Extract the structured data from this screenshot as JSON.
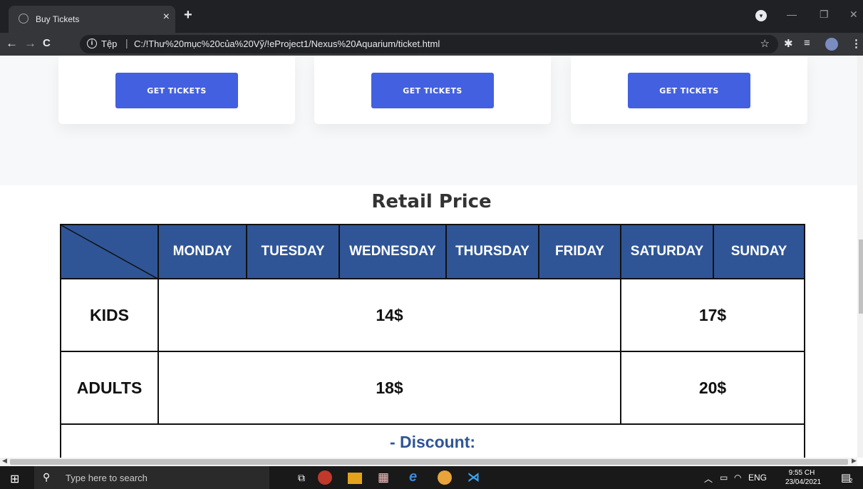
{
  "browser": {
    "tab_title": "Buy Tickets",
    "tab_close": "×",
    "new_tab": "+",
    "scheme_label": "Tệp",
    "separator": "|",
    "url": "C:/!Thư%20mục%20của%20Vỹ/!eProject1/Nexus%20Aquarium/ticket.html",
    "minimize": "—",
    "restore": "❐",
    "close": "✕"
  },
  "cards": [
    {
      "button_label": "GET TICKETS"
    },
    {
      "button_label": "GET TICKETS"
    },
    {
      "button_label": "GET TICKETS"
    }
  ],
  "retail": {
    "title": "Retail Price",
    "days": [
      "MONDAY",
      "TUESDAY",
      "WEDNESDAY",
      "THURSDAY",
      "FRIDAY",
      "SATURDAY",
      "SUNDAY"
    ],
    "rows": [
      {
        "label": "KIDS",
        "weekday_price": "14$",
        "weekend_price": "17$"
      },
      {
        "label": "ADULTS",
        "weekday_price": "18$",
        "weekend_price": "20$"
      }
    ],
    "discount_label": "- Discount:"
  },
  "taskbar": {
    "search_placeholder": "Type here to search",
    "lang": "ENG",
    "time": "9:55 CH",
    "date": "23/04/2021",
    "notifications": "2"
  },
  "colors": {
    "header_blue": "#2f5597",
    "button_blue": "#4360e0",
    "chrome_dark": "#202124"
  }
}
